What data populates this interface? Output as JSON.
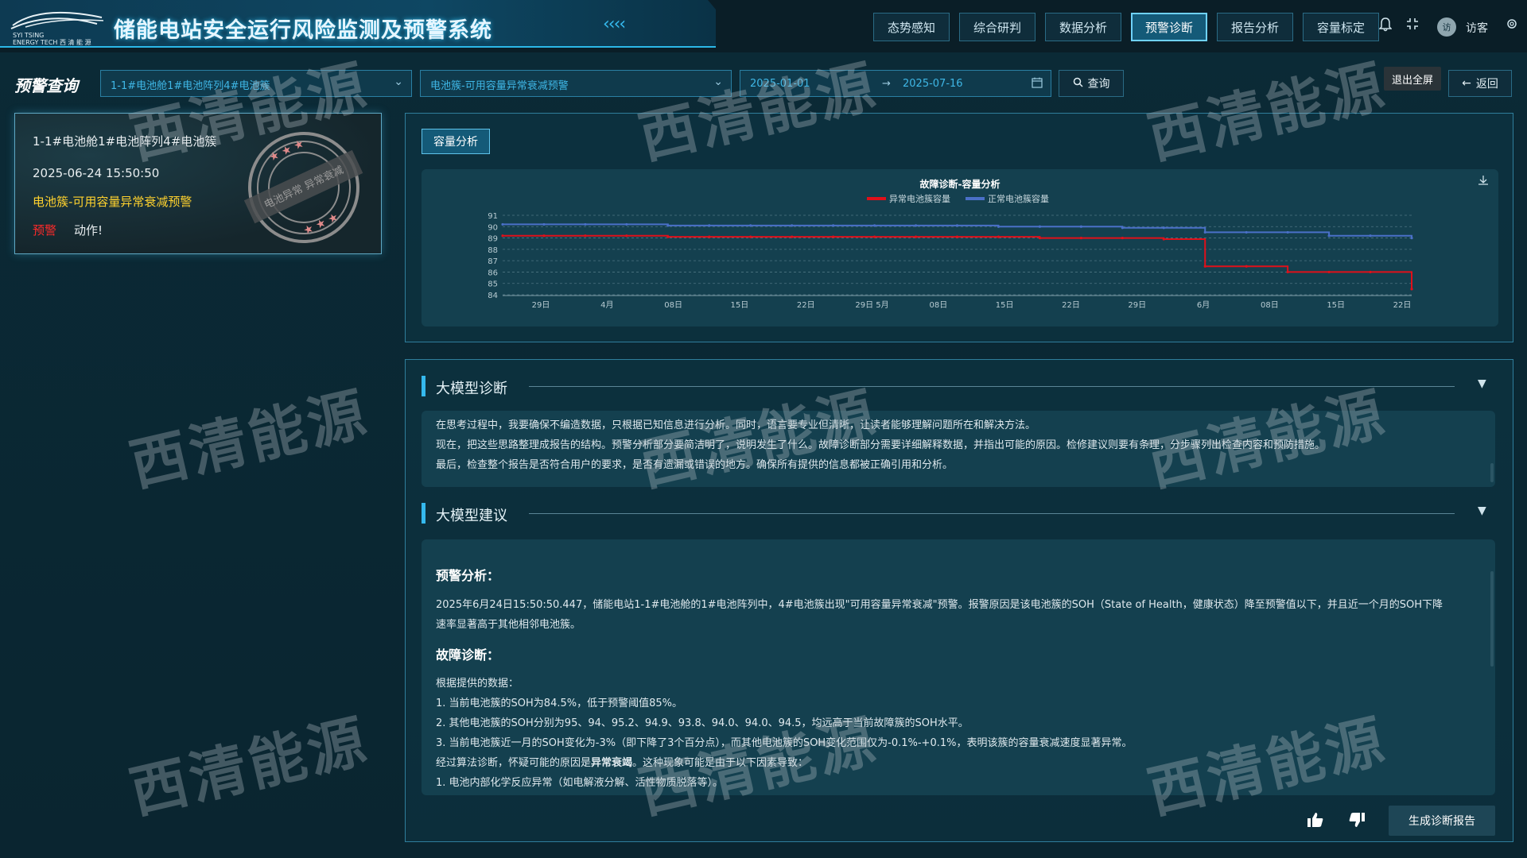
{
  "header": {
    "logo_text_line1": "SYI TSING",
    "logo_text_line2": "ENERGY TECH 西 清 能 源",
    "title": "储能电站安全运行风险监测及预警系统",
    "chevrons": "‹‹‹‹",
    "nav": [
      "态势感知",
      "综合研判",
      "数据分析",
      "预警诊断",
      "报告分析",
      "容量标定"
    ],
    "active_nav": "预警诊断",
    "avatar_text": "访",
    "user_name": "访客"
  },
  "query": {
    "label": "预警查询",
    "device": "1-1#电池舱1#电池阵列4#电池簇",
    "alarm_type": "电池簇-可用容量异常衰减预警",
    "date_start": "2025-01-01",
    "date_sep": "→",
    "date_end": "2025-07-16",
    "query_button": "查询",
    "exit_fullscreen": "退出全屏",
    "back_button": "返回"
  },
  "alert_card": {
    "device": "1-1#电池舱1#电池阵列4#电池簇",
    "time": "2025-06-24 15:50:50",
    "type": "电池簇-可用容量异常衰减预警",
    "level": "预警",
    "action": "动作!",
    "stamp_text": "电池异常 异常衰减",
    "level_color": "#ff2a2a",
    "type_color": "#ffd22e"
  },
  "capacity_tab": "容量分析",
  "chart_data": {
    "type": "line",
    "title": "故障诊断-容量分析",
    "ylim": [
      84,
      91
    ],
    "yticks": [
      84,
      85,
      86,
      87,
      88,
      89,
      90,
      91
    ],
    "xtick_labels": [
      "29日",
      "4月",
      "08日",
      "15日",
      "22日",
      "29日 5月",
      "08日",
      "15日",
      "22日",
      "29日",
      "6月",
      "08日",
      "15日",
      "22日"
    ],
    "series": [
      {
        "name": "异常电池簇容量",
        "color": "#e0101a",
        "values": [
          89.2,
          89.2,
          89.2,
          89.2,
          89.1,
          89.1,
          89.1,
          89.1,
          89.1,
          89.1,
          89.1,
          89.1,
          89.1,
          89.0,
          89.0,
          89.0,
          88.9,
          86.5,
          86.5,
          86.0,
          86.0,
          86.0,
          84.5
        ]
      },
      {
        "name": "正常电池簇容量",
        "color": "#4a70c8",
        "values": [
          90.2,
          90.2,
          90.2,
          90.2,
          90.1,
          90.1,
          90.1,
          90.1,
          90.1,
          90.1,
          90.1,
          90.1,
          90.0,
          90.0,
          90.0,
          89.9,
          89.9,
          89.5,
          89.5,
          89.5,
          89.2,
          89.2,
          89.0
        ]
      }
    ]
  },
  "llm_diagnosis": {
    "title": "大模型诊断",
    "lines": [
      "在思考过程中，我要确保不编造数据，只根据已知信息进行分析。同时，语言要专业但清晰，让读者能够理解问题所在和解决方法。",
      "现在，把这些思路整理成报告的结构。预警分析部分要简洁明了，说明发生了什么。故障诊断部分需要详细解释数据，并指出可能的原因。检修建议则要有条理，分步骤列出检查内容和预防措施。",
      "最后，检查整个报告是否符合用户的要求，是否有遗漏或错误的地方。确保所有提供的信息都被正确引用和分析。"
    ]
  },
  "llm_advice": {
    "title": "大模型建议",
    "h1": "预警分析：",
    "p1_line1": "2025年6月24日15:50:50.447，储能电站1-1#电池舱的1#电池阵列中，4#电池簇出现\"可用容量异常衰减\"预警。报警原因是该电池簇的SOH（State of Health，健康状态）降至预警值以下，并且近一个月的SOH下降",
    "p1_line2": "速率显著高于其他相邻电池簇。",
    "h2": "故障诊断：",
    "l1": "根据提供的数据：",
    "l2": "1. 当前电池簇的SOH为84.5%，低于预警阈值85%。",
    "l3": "2. 其他电池簇的SOH分别为95、94、95.2、94.9、93.8、94.0、94.0、94.5，均远高于当前故障簇的SOH水平。",
    "l4": "3. 当前电池簇近一月的SOH变化为-3%（即下降了3个百分点），而其他电池簇的SOH变化范围仅为-0.1%-+0.1%，表明该簇的容量衰减速度显著异常。",
    "l5_pre": "经过算法诊断，怀疑可能的原因是",
    "l5_bold": "异常衰竭",
    "l5_post": "。这种现象可能是由于以下因素导致：",
    "l6": "1. 电池内部化学反应异常（如电解液分解、活性物质脱落等）。"
  },
  "footer": {
    "like_icon": "thumbs-up-icon",
    "dislike_icon": "thumbs-down-icon",
    "generate_button": "生成诊断报告"
  },
  "watermark": "西清能源"
}
